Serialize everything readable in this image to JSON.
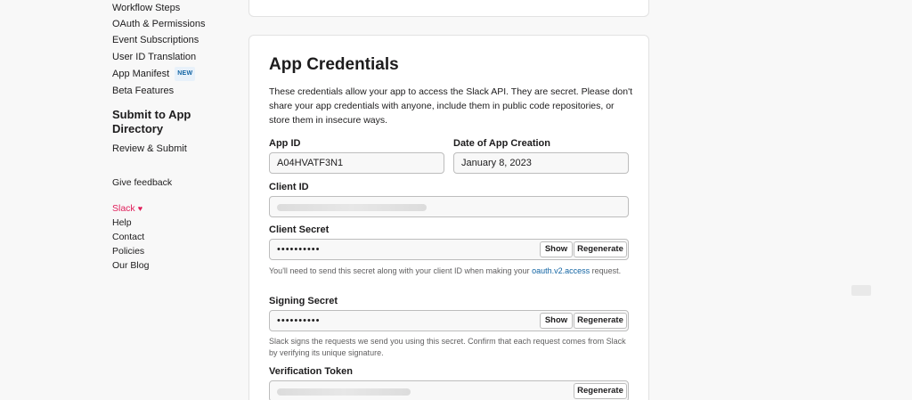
{
  "sidebar": {
    "items": [
      {
        "label": "Workflow Steps"
      },
      {
        "label": "OAuth & Permissions"
      },
      {
        "label": "Event Subscriptions"
      },
      {
        "label": "User ID Translation"
      },
      {
        "label": "App Manifest",
        "badge": "NEW"
      },
      {
        "label": "Beta Features"
      }
    ],
    "submit_section": {
      "heading": "Submit to App Directory",
      "items": [
        {
          "label": "Review & Submit"
        }
      ]
    },
    "feedback_label": "Give feedback",
    "footer_links": [
      {
        "label": "Slack"
      },
      {
        "label": "Help"
      },
      {
        "label": "Contact"
      },
      {
        "label": "Policies"
      },
      {
        "label": "Our Blog"
      }
    ]
  },
  "credentials": {
    "title": "App Credentials",
    "description": "These credentials allow your app to access the Slack API. They are secret. Please don't share your app credentials with anyone, include them in public code repositories, or store them in insecure ways.",
    "app_id": {
      "label": "App ID",
      "value": "A04HVATF3N1"
    },
    "creation_date": {
      "label": "Date of App Creation",
      "value": "January 8, 2023"
    },
    "client_id": {
      "label": "Client ID"
    },
    "client_secret": {
      "label": "Client Secret",
      "value": "••••••••••",
      "show_label": "Show",
      "regenerate_label": "Regenerate",
      "hint_prefix": "You'll need to send this secret along with your client ID when making your ",
      "hint_link": "oauth.v2.access",
      "hint_suffix": " request."
    },
    "signing_secret": {
      "label": "Signing Secret",
      "value": "••••••••••",
      "show_label": "Show",
      "regenerate_label": "Regenerate",
      "hint": "Slack signs the requests we send you using this secret. Confirm that each request comes from Slack by verifying its unique signature."
    },
    "verification_token": {
      "label": "Verification Token",
      "regenerate_label": "Regenerate"
    }
  },
  "colors": {
    "page_bg": "#f8f8f8",
    "card_bg": "#ffffff",
    "link_blue": "#1264a3",
    "slack_red": "#e01e5a"
  },
  "icons": {
    "slack_heart": "heart-icon"
  }
}
